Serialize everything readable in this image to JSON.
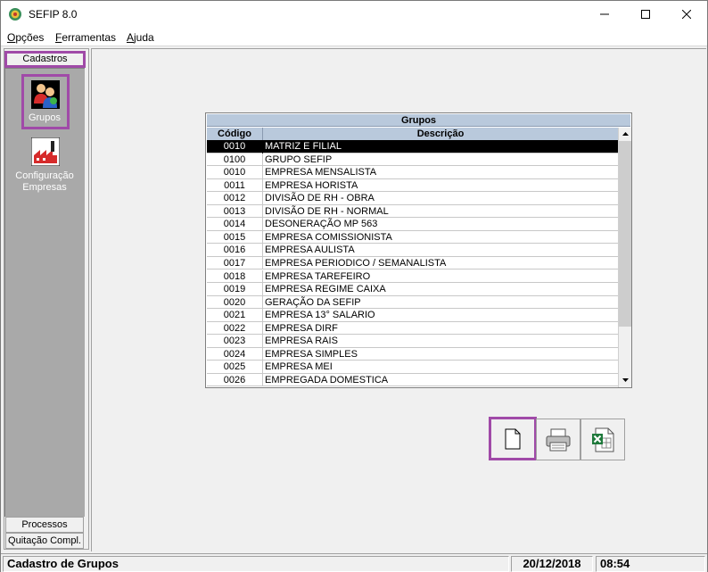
{
  "window": {
    "title": "SEFIP 8.0",
    "controls": {
      "minimize": "minimize-icon",
      "maximize": "maximize-icon",
      "close": "close-icon"
    }
  },
  "menu": {
    "items": [
      {
        "label": "Opções",
        "mnemonic": "O"
      },
      {
        "label": "Ferramentas",
        "mnemonic": "F"
      },
      {
        "label": "Ajuda",
        "mnemonic": "A"
      }
    ]
  },
  "sidebar": {
    "tabs": {
      "cadastros": "Cadastros",
      "processos": "Processos",
      "quitacao": "Quitação Compl."
    },
    "items": [
      {
        "label": "Grupos",
        "icon": "users-group-icon"
      },
      {
        "label_line1": "Configuração",
        "label_line2": "Empresas",
        "icon": "factory-icon"
      }
    ]
  },
  "grid": {
    "title": "Grupos",
    "columns": [
      "Código",
      "Descrição"
    ],
    "rows": [
      {
        "codigo": "0010",
        "descricao": "MATRIZ E FILIAL",
        "selected": true
      },
      {
        "codigo": "0100",
        "descricao": "GRUPO SEFIP"
      },
      {
        "codigo": "0010",
        "descricao": "EMPRESA MENSALISTA"
      },
      {
        "codigo": "0011",
        "descricao": "EMPRESA HORISTA"
      },
      {
        "codigo": "0012",
        "descricao": "DIVISÃO DE RH - OBRA"
      },
      {
        "codigo": "0013",
        "descricao": "DIVISÃO DE RH - NORMAL"
      },
      {
        "codigo": "0014",
        "descricao": "DESONERAÇÃO MP 563"
      },
      {
        "codigo": "0015",
        "descricao": "EMPRESA COMISSIONISTA"
      },
      {
        "codigo": "0016",
        "descricao": "EMPRESA AULISTA"
      },
      {
        "codigo": "0017",
        "descricao": "EMPRESA PERIODICO / SEMANALISTA"
      },
      {
        "codigo": "0018",
        "descricao": "EMPRESA TAREFEIRO"
      },
      {
        "codigo": "0019",
        "descricao": "EMPRESA REGIME CAIXA"
      },
      {
        "codigo": "0020",
        "descricao": "GERAÇÃO DA SEFIP"
      },
      {
        "codigo": "0021",
        "descricao": "EMPRESA 13° SALARIO"
      },
      {
        "codigo": "0022",
        "descricao": "EMPRESA DIRF"
      },
      {
        "codigo": "0023",
        "descricao": "EMPRESA RAIS"
      },
      {
        "codigo": "0024",
        "descricao": "EMPRESA SIMPLES"
      },
      {
        "codigo": "0025",
        "descricao": "EMPRESA MEI"
      },
      {
        "codigo": "0026",
        "descricao": "EMPREGADA DOMESTICA"
      }
    ]
  },
  "toolbar": {
    "buttons": [
      {
        "name": "new",
        "icon": "new-document-icon"
      },
      {
        "name": "print",
        "icon": "printer-icon"
      },
      {
        "name": "export",
        "icon": "excel-export-icon"
      }
    ]
  },
  "status": {
    "message": "Cadastro de Grupos",
    "date": "20/12/2018",
    "time": "08:54"
  },
  "colors": {
    "highlight": "#a04aa8",
    "grid_header": "#b9c9dc",
    "sidebar_panel": "#a9a9a9"
  }
}
